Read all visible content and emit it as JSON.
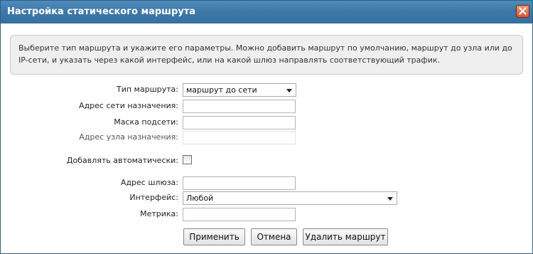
{
  "dialog": {
    "title": "Настройка статического маршрута",
    "close_icon": "close-icon"
  },
  "info": {
    "line1": "Выберите тип маршрута и укажите его параметры. Можно добавить маршрут по умолчанию, маршрут до узла или до",
    "line2": "IP-сети, и указать через какой интерфейс, или на какой шлюз направлять соответствующий трафик."
  },
  "form": {
    "route_type_label": "Тип маршрута:",
    "route_type_value": "маршрут до сети",
    "dest_network_label": "Адрес сети назначения:",
    "dest_network_value": "",
    "netmask_label": "Маска подсети:",
    "netmask_value": "",
    "dest_host_label": "Адрес узла назначения:",
    "dest_host_value": "",
    "auto_add_label": "Добавлять автоматически:",
    "auto_add_checked": false,
    "gateway_label": "Адрес шлюза:",
    "gateway_value": "",
    "interface_label": "Интерфейс:",
    "interface_value": "Любой",
    "metric_label": "Метрика:",
    "metric_value": ""
  },
  "buttons": {
    "apply": "Применить",
    "cancel": "Отмена",
    "delete": "Удалить маршрут"
  }
}
